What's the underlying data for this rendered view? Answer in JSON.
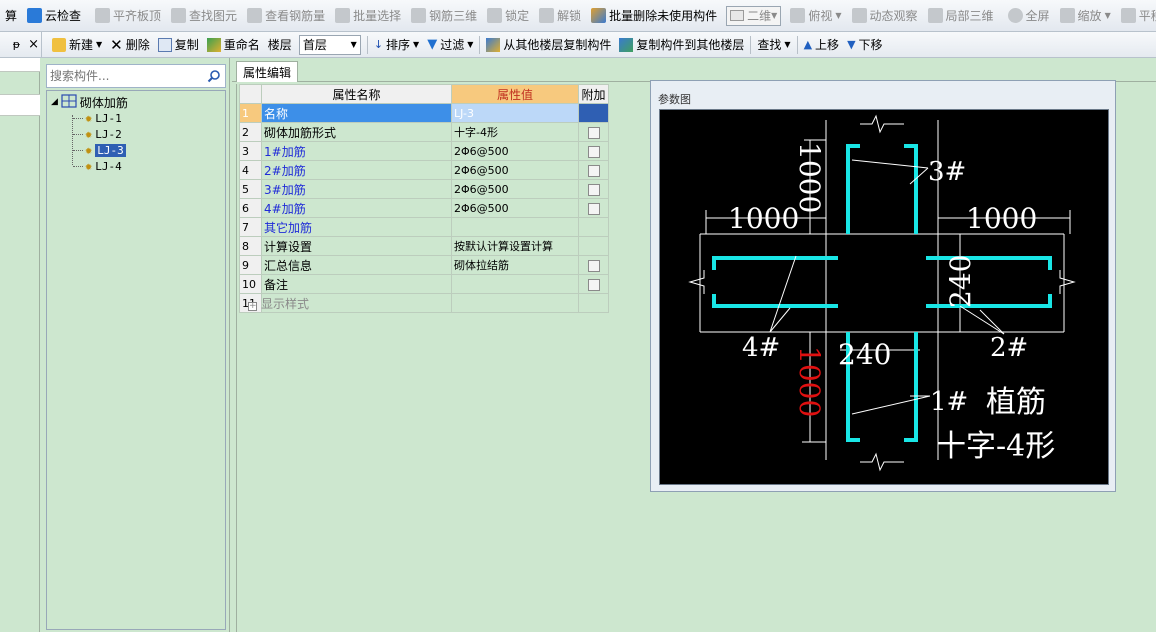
{
  "toolbar1": {
    "items": [
      {
        "label": "算",
        "enabled": true
      },
      {
        "label": "云检查",
        "enabled": true
      },
      {
        "label": "平齐板顶",
        "enabled": false
      },
      {
        "label": "查找图元",
        "enabled": false
      },
      {
        "label": "查看钢筋量",
        "enabled": false
      },
      {
        "label": "批量选择",
        "enabled": false
      },
      {
        "label": "钢筋三维",
        "enabled": false
      },
      {
        "label": "锁定",
        "enabled": false
      },
      {
        "label": "解锁",
        "enabled": false
      },
      {
        "label": "批量删除未使用构件",
        "enabled": true
      },
      {
        "label": "二维",
        "enabled": false
      },
      {
        "label": "俯视",
        "enabled": false
      },
      {
        "label": "动态观察",
        "enabled": false
      },
      {
        "label": "局部三维",
        "enabled": false
      },
      {
        "label": "全屏",
        "enabled": false
      },
      {
        "label": "缩放",
        "enabled": false
      },
      {
        "label": "平移",
        "enabled": false
      }
    ]
  },
  "toolbar2": {
    "pin": "ᵽ",
    "close": "×",
    "new": "新建",
    "delete": "删除",
    "copy": "复制",
    "rename": "重命名",
    "floor_label": "楼层",
    "floor_value": "首层",
    "sort": "排序",
    "filter": "过滤",
    "copy_from_floor": "从其他楼层复制构件",
    "copy_to_floor": "复制构件到其他楼层",
    "find": "查找",
    "move_up": "上移",
    "move_down": "下移"
  },
  "tree": {
    "search_placeholder": "搜索构件...",
    "root": "砌体加筋",
    "children": [
      "LJ-1",
      "LJ-2",
      "LJ-3",
      "LJ-4"
    ],
    "selected_index": 2
  },
  "props": {
    "tab": "属性编辑",
    "headers": {
      "name": "属性名称",
      "value": "属性值",
      "extra": "附加"
    },
    "rows": [
      {
        "no": "1",
        "name": "名称",
        "value": "LJ-3",
        "checkbox": false,
        "style": "selected"
      },
      {
        "no": "2",
        "name": "砌体加筋形式",
        "value": "十字-4形",
        "checkbox": true,
        "style": "normal"
      },
      {
        "no": "3",
        "name": "1#加筋",
        "value": "2Φ6@500",
        "checkbox": true,
        "style": "blue"
      },
      {
        "no": "4",
        "name": "2#加筋",
        "value": "2Φ6@500",
        "checkbox": true,
        "style": "blue"
      },
      {
        "no": "5",
        "name": "3#加筋",
        "value": "2Φ6@500",
        "checkbox": true,
        "style": "blue"
      },
      {
        "no": "6",
        "name": "4#加筋",
        "value": "2Φ6@500",
        "checkbox": true,
        "style": "blue"
      },
      {
        "no": "7",
        "name": "其它加筋",
        "value": "",
        "checkbox": false,
        "style": "blue"
      },
      {
        "no": "8",
        "name": "计算设置",
        "value": "按默认计算设置计算",
        "checkbox": false,
        "style": "normal"
      },
      {
        "no": "9",
        "name": "汇总信息",
        "value": "砌体拉结筋",
        "checkbox": true,
        "style": "normal"
      },
      {
        "no": "10",
        "name": "备注",
        "value": "",
        "checkbox": true,
        "style": "normal"
      },
      {
        "no": "11",
        "name": "显示样式",
        "value": "",
        "checkbox": false,
        "style": "gray-expand"
      }
    ]
  },
  "param": {
    "title": "参数图",
    "dim_left": "1000",
    "dim_right": "1000",
    "dim_top": "1000",
    "dim_bottom": "1000",
    "dim_vertical_240": "240",
    "dim_horizontal_240": "240",
    "label_1": "1#",
    "label_2": "2#",
    "label_3": "3#",
    "label_4": "4#",
    "caption1": "植筋",
    "caption2": "十字-4形",
    "colors": {
      "rebar": "#19e6e6",
      "dim": "#ffffff",
      "highlight": "#e01010",
      "background": "#000000"
    }
  }
}
